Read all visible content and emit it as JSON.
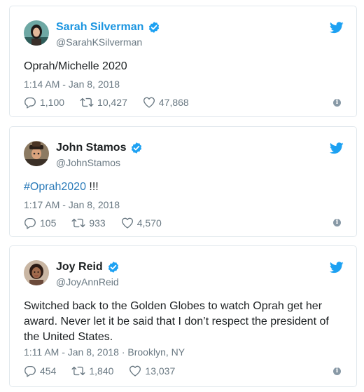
{
  "tweets": [
    {
      "name": "Sarah Silverman",
      "handle": "@SarahKSilverman",
      "text": "Oprah/Michelle 2020",
      "timestamp": "1:14 AM - Jan 8, 2018",
      "replies": "1,100",
      "retweets": "10,427",
      "likes": "47,868"
    },
    {
      "name": "John Stamos",
      "handle": "@JohnStamos",
      "hashtag": "#Oprah2020",
      "text_suffix": " !!!",
      "timestamp": "1:17 AM - Jan 8, 2018",
      "replies": "105",
      "retweets": "933",
      "likes": "4,570"
    },
    {
      "name": "Joy Reid",
      "handle": "@JoyAnnReid",
      "text": "Switched back to the Golden Globes to watch Oprah get her award. Never let it be said that I don’t respect the president of the United States.",
      "timestamp": "1:11 AM - Jan 8, 2018 · Brooklyn, NY",
      "replies": "454",
      "retweets": "1,840",
      "likes": "13,037"
    }
  ],
  "icons": {
    "verified": "verified-badge-icon",
    "twitter": "twitter-bird-icon",
    "reply": "reply-icon",
    "retweet": "retweet-icon",
    "like": "heart-icon",
    "info": "info-icon"
  },
  "colors": {
    "accent": "#1da1f2",
    "name_link": "#1b95e0",
    "hashtag": "#2b7bb9",
    "muted": "#697882",
    "border": "#e1e8ed"
  }
}
